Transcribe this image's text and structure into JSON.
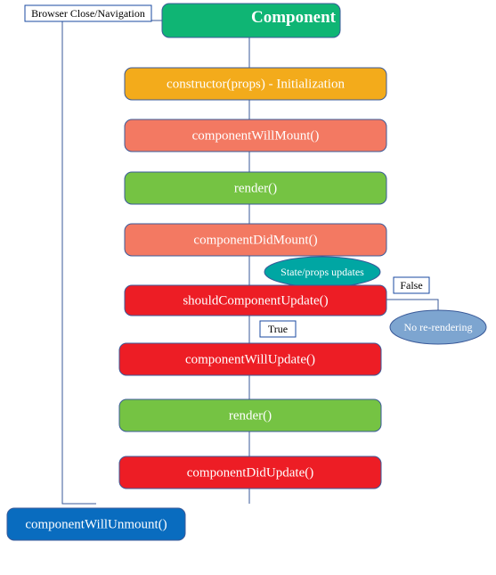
{
  "title": "Component",
  "nodes": {
    "constructor": "constructor(props) - Initialization",
    "willMount": "componentWillMount()",
    "render1": "render()",
    "didMount": "componentDidMount()",
    "stateProps": "State/props updates",
    "shouldUpdate": "shouldComponentUpdate()",
    "willUpdate": "componentWillUpdate()",
    "render2": "render()",
    "didUpdate": "componentDidUpdate()",
    "noRerender": "No re-rendering",
    "willUnmount": "componentWillUnmount()"
  },
  "tags": {
    "browserClose": "Browser Close/Navigation",
    "true": "True",
    "false": "False"
  },
  "colors": {
    "title": "#0fb574",
    "orange": "#f3ab1b",
    "coral": "#f37962",
    "green": "#75c343",
    "red": "#ed1d25",
    "blueSolid": "#096cbf",
    "teal": "#00a6a3",
    "blueSoft": "#7da5d0"
  },
  "chart_data": {
    "type": "diagram",
    "title": "React Component Lifecycle",
    "nodes": [
      {
        "id": "component",
        "label": "Component",
        "kind": "start"
      },
      {
        "id": "constructor",
        "label": "constructor(props) - Initialization"
      },
      {
        "id": "componentWillMount",
        "label": "componentWillMount()"
      },
      {
        "id": "render-mount",
        "label": "render()"
      },
      {
        "id": "componentDidMount",
        "label": "componentDidMount()"
      },
      {
        "id": "state-props-updates",
        "label": "State/props updates",
        "kind": "event"
      },
      {
        "id": "shouldComponentUpdate",
        "label": "shouldComponentUpdate()",
        "kind": "decision"
      },
      {
        "id": "componentWillUpdate",
        "label": "componentWillUpdate()"
      },
      {
        "id": "render-update",
        "label": "render()"
      },
      {
        "id": "componentDidUpdate",
        "label": "componentDidUpdate()"
      },
      {
        "id": "no-re-rendering",
        "label": "No re-rendering",
        "kind": "terminal"
      },
      {
        "id": "componentWillUnmount",
        "label": "componentWillUnmount()"
      }
    ],
    "edges": [
      {
        "from": "component",
        "to": "constructor"
      },
      {
        "from": "constructor",
        "to": "componentWillMount"
      },
      {
        "from": "componentWillMount",
        "to": "render-mount"
      },
      {
        "from": "render-mount",
        "to": "componentDidMount"
      },
      {
        "from": "componentDidMount",
        "to": "state-props-updates"
      },
      {
        "from": "state-props-updates",
        "to": "shouldComponentUpdate"
      },
      {
        "from": "shouldComponentUpdate",
        "to": "componentWillUpdate",
        "label": "True"
      },
      {
        "from": "shouldComponentUpdate",
        "to": "no-re-rendering",
        "label": "False"
      },
      {
        "from": "componentWillUpdate",
        "to": "render-update"
      },
      {
        "from": "render-update",
        "to": "componentDidUpdate"
      },
      {
        "from": "component",
        "to": "componentWillUnmount",
        "label": "Browser Close/Navigation"
      }
    ]
  }
}
